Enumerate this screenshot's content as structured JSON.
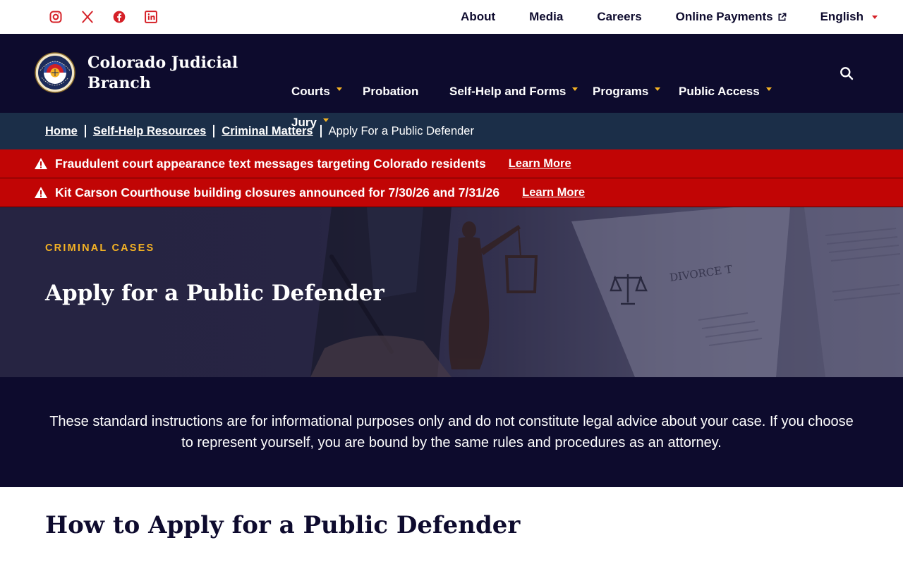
{
  "utility_nav": {
    "social": [
      {
        "name": "instagram-icon"
      },
      {
        "name": "x-icon"
      },
      {
        "name": "facebook-icon"
      },
      {
        "name": "linkedin-icon"
      }
    ],
    "links": [
      "About",
      "Media",
      "Careers",
      "Online Payments"
    ],
    "language": "English"
  },
  "header": {
    "brand": "Colorado Judicial Branch",
    "nav": [
      "Courts",
      "Probation",
      "Self-Help and Forms",
      "Programs",
      "Public Access",
      "Jury"
    ]
  },
  "breadcrumb": {
    "links": [
      "Home",
      "Self-Help Resources",
      "Criminal Matters"
    ],
    "current": "Apply For a Public Defender"
  },
  "alerts": [
    {
      "message": "Fraudulent court appearance text messages targeting Colorado residents",
      "link": "Learn More"
    },
    {
      "message": "Kit Carson Courthouse building closures announced for 7/30/26 and 7/31/26",
      "link": "Learn More"
    }
  ],
  "hero": {
    "eyebrow": "CRIMINAL CASES",
    "title": "Apply for a Public Defender"
  },
  "disclaimer": "These standard instructions are for informational purposes only and do not constitute legal advice about your case. If you choose to represent yourself, you are bound by the same rules and procedures as an attorney.",
  "section": {
    "heading": "How to Apply for a Public Defender"
  },
  "colors": {
    "navy": "#0d0b2d",
    "breadcrumb_bg": "#1b2e48",
    "alert_red": "#c10505",
    "accent_gold": "#f5b324",
    "social_red": "#d52027"
  }
}
